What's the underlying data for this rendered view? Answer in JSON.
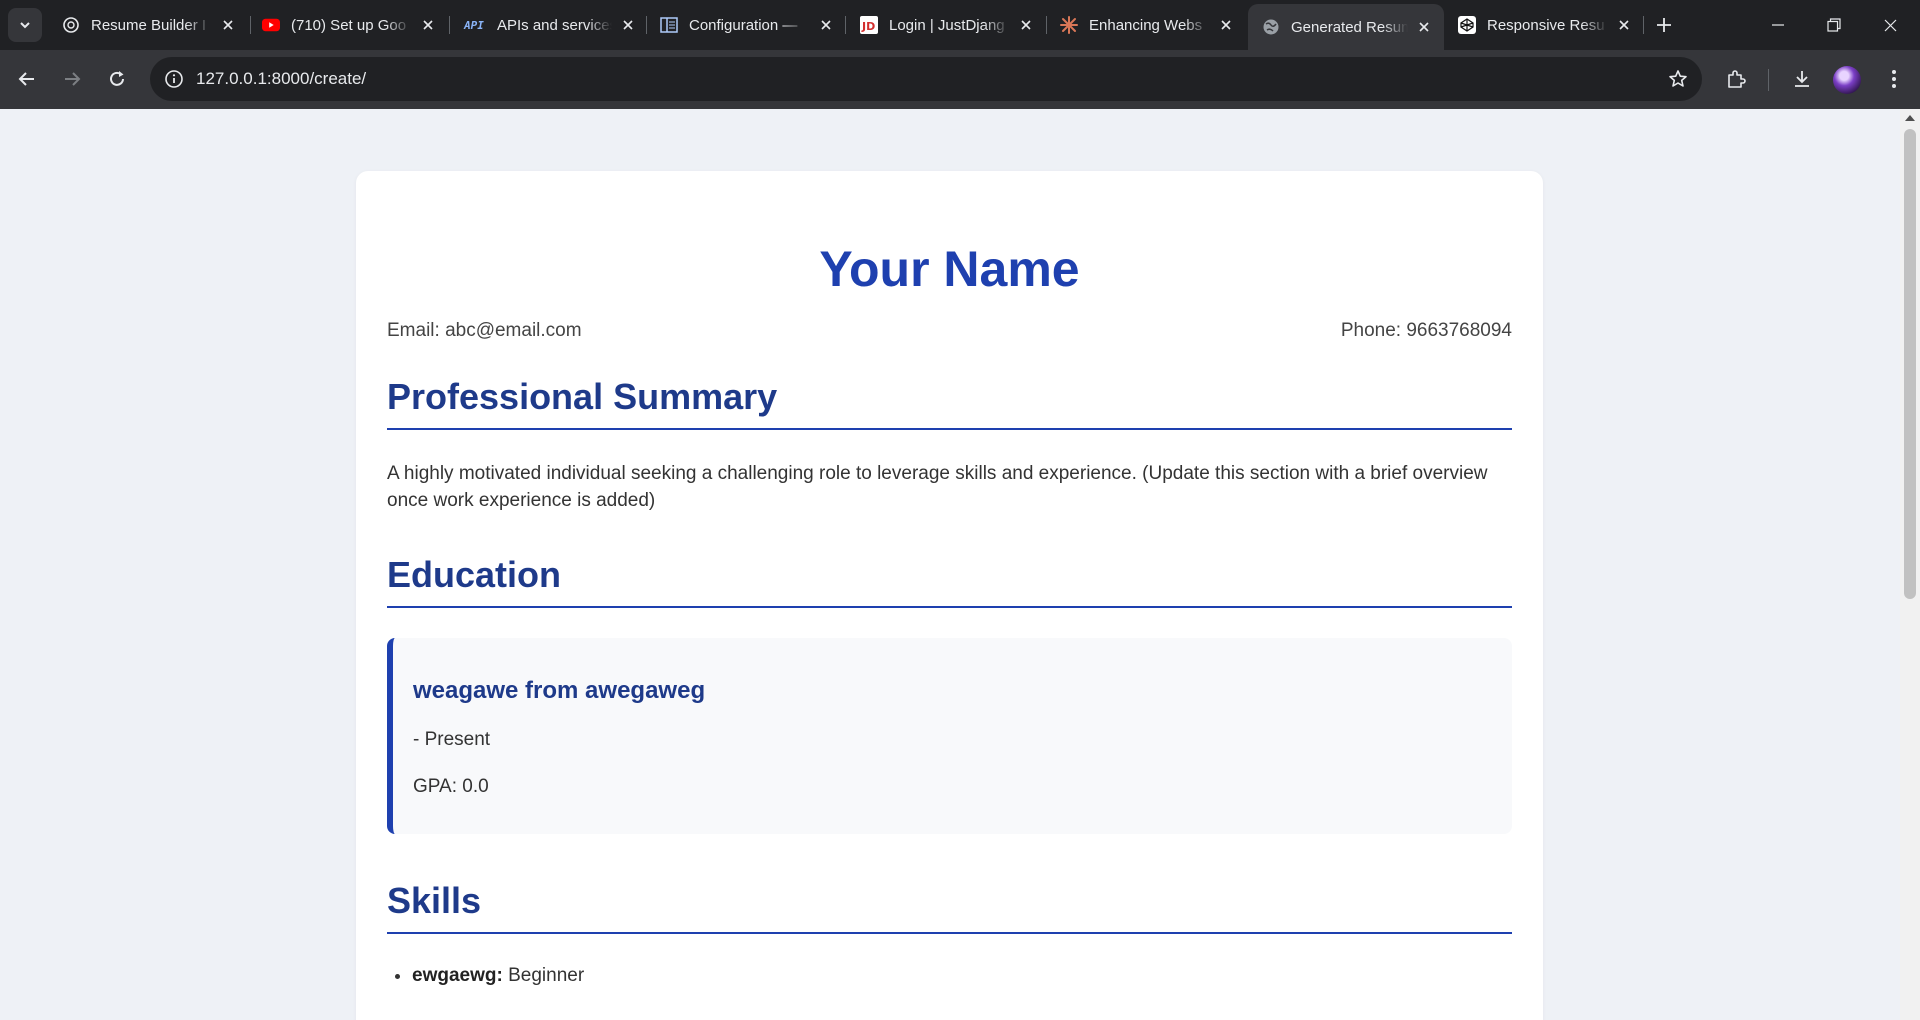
{
  "browser": {
    "tabs": [
      {
        "title": "Resume Builder I",
        "icon": "openai-icon",
        "active": false
      },
      {
        "title": "(710) Set up Goo",
        "icon": "youtube-icon",
        "active": false
      },
      {
        "title": "APIs and services",
        "icon": "api-icon",
        "active": false
      },
      {
        "title": "Configuration —",
        "icon": "config-icon",
        "active": false
      },
      {
        "title": "Login | JustDjang",
        "icon": "justdjango-icon",
        "active": false
      },
      {
        "title": "Enhancing Webs",
        "icon": "claude-icon",
        "active": false
      },
      {
        "title": "Generated Resum",
        "icon": "globe-icon",
        "active": true
      },
      {
        "title": "Responsive Resu",
        "icon": "codepen-icon",
        "active": false
      }
    ],
    "url": "127.0.0.1:8000/create/"
  },
  "resume": {
    "name": "Your Name",
    "email": "Email: abc@email.com",
    "phone": "Phone: 9663768094",
    "summary_heading": "Professional Summary",
    "summary_text": "A highly motivated individual seeking a challenging role to leverage skills and experience. (Update this section with a brief overview once work experience is added)",
    "education_heading": "Education",
    "education": [
      {
        "title": "weagawe from awegaweg",
        "dates": "- Present",
        "gpa": "GPA: 0.0"
      }
    ],
    "skills_heading": "Skills",
    "skills": [
      {
        "name": "ewgaewg:",
        "level": "Beginner"
      }
    ]
  },
  "colors": {
    "accent": "#1e40af",
    "heading": "#1e3a8a",
    "page_bg": "#eef1f6",
    "chrome_dark": "#202124",
    "chrome_toolbar": "#35363a"
  }
}
